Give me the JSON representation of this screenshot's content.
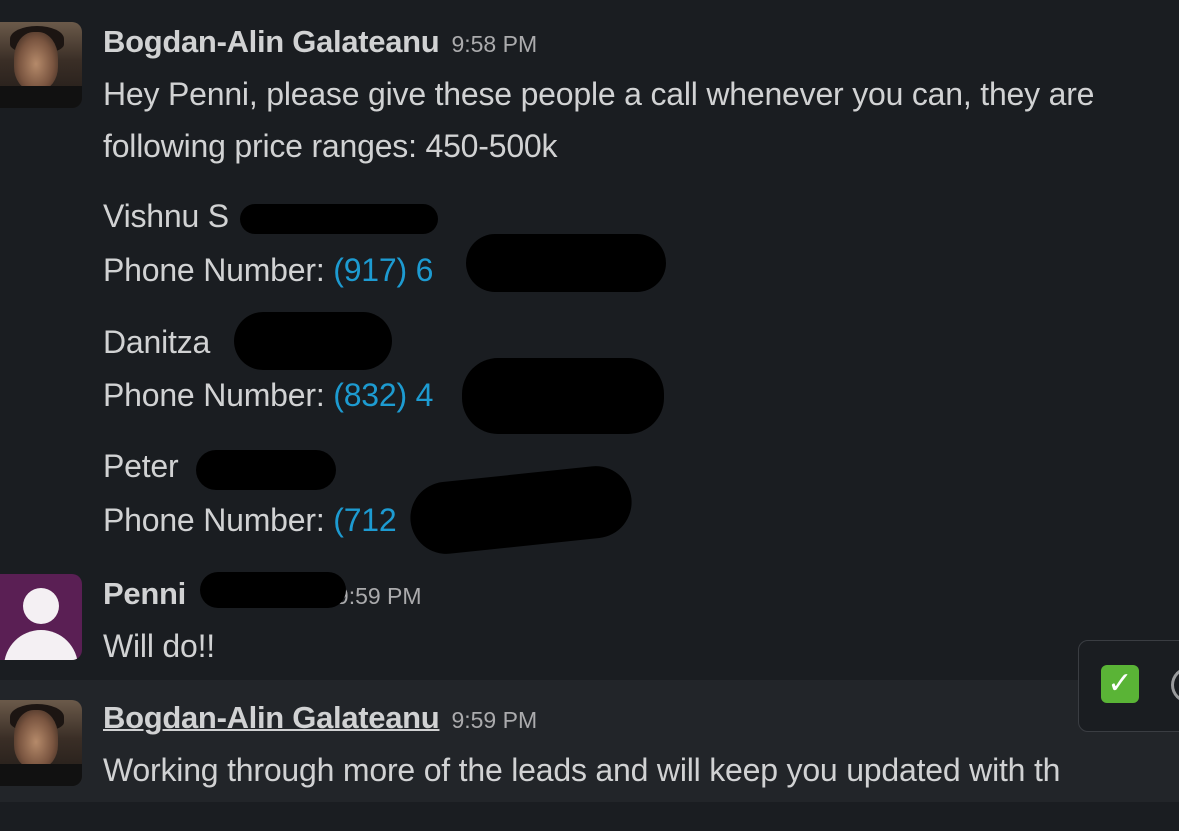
{
  "messages": [
    {
      "sender": "Bogdan-Alin Galateanu",
      "time": "9:58 PM",
      "lines": [
        "Hey Penni, please give these people a call whenever you can, they are",
        "following price ranges: 450-500k"
      ],
      "contacts": [
        {
          "name": "Vishnu S",
          "phone_label": "Phone Number:",
          "phone": "(917) 6"
        },
        {
          "name": "Danitza",
          "phone_label": "Phone Number:",
          "phone": "(832) 4"
        },
        {
          "name": "Peter",
          "phone_label": "Phone Number:",
          "phone": "(712"
        }
      ]
    },
    {
      "sender": "Penni",
      "time": "9:59 PM",
      "lines": [
        "Will do!!"
      ]
    },
    {
      "sender": "Bogdan-Alin Galateanu",
      "time": "9:59 PM",
      "lines": [
        "Working through more of the leads and will keep you updated with th"
      ]
    }
  ],
  "hover_actions": {
    "reaction_icon": "white-check-mark-icon",
    "more_icon": "more-actions-icon"
  },
  "colors": {
    "background": "#1a1d21",
    "text": "#d1d2d3",
    "link": "#1d9bd1",
    "timestamp": "#ababad",
    "check": "#5ab436"
  }
}
